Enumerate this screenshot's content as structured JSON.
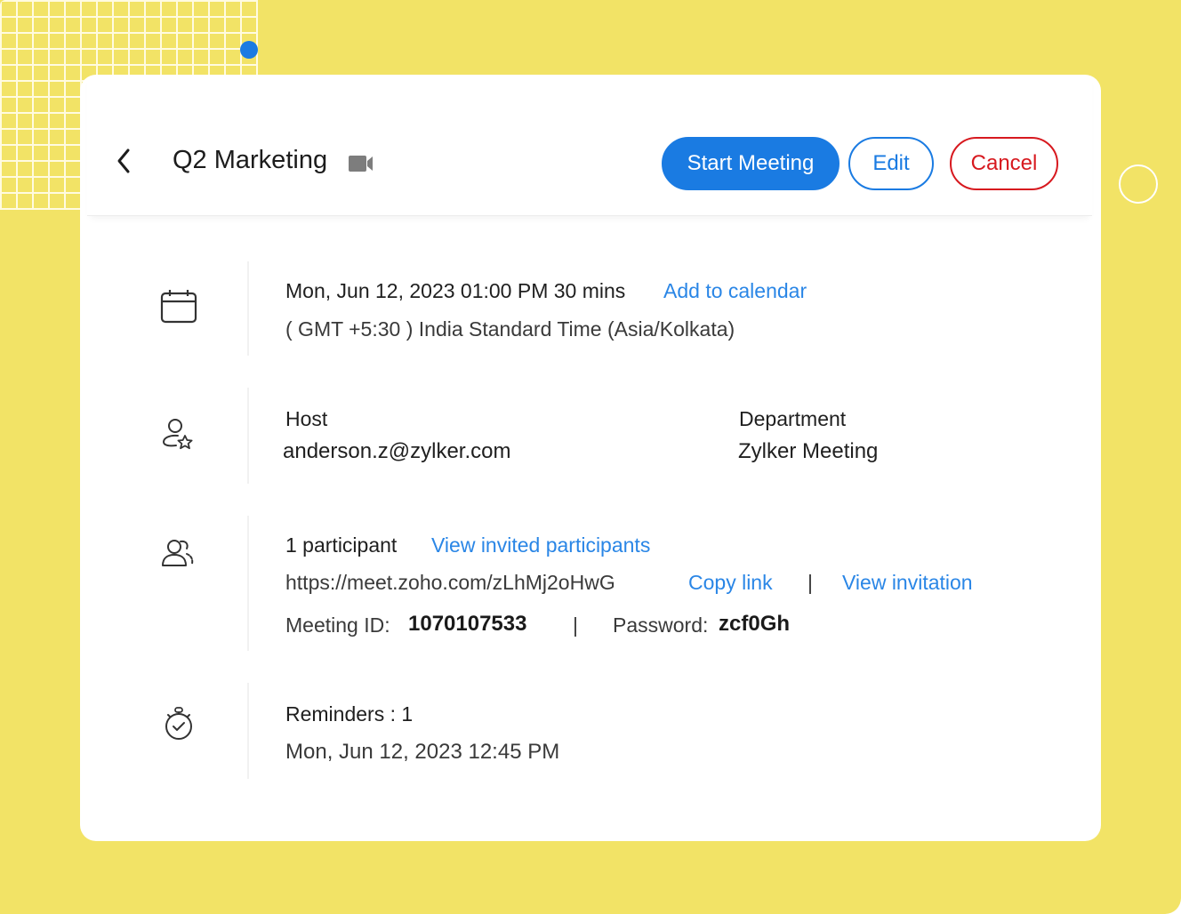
{
  "header": {
    "back_label": "Back",
    "title": "Q2 Marketing",
    "meeting_type_icon": "video-camera-icon",
    "buttons": {
      "start": "Start Meeting",
      "edit": "Edit",
      "cancel": "Cancel"
    }
  },
  "schedule": {
    "icon": "calendar-icon",
    "datetime": "Mon, Jun 12, 2023 01:00 PM 30 mins",
    "add_to_calendar": "Add to calendar",
    "timezone": "( GMT +5:30 ) India Standard Time (Asia/Kolkata)"
  },
  "host": {
    "icon": "host-user-star-icon",
    "host_label": "Host",
    "host_value": "anderson.z@zylker.com",
    "department_label": "Department",
    "department_value": "Zylker Meeting"
  },
  "participants": {
    "icon": "participants-icon",
    "count": "1 participant",
    "view_invited": "View invited participants",
    "link": "https://meet.zoho.com/zLhMj2oHwG",
    "copy_link": "Copy link",
    "separator": "|",
    "view_invitation": "View invitation",
    "meeting_id_label": "Meeting ID:",
    "meeting_id": "1070107533",
    "password_label": "Password:",
    "password": "zcf0Gh"
  },
  "reminders": {
    "icon": "stopwatch-icon",
    "label": "Reminders : 1",
    "time": "Mon, Jun 12, 2023 12:45 PM"
  },
  "colors": {
    "primary": "#1a7be2",
    "danger": "#d7191f",
    "link": "#2a86e6",
    "background": "#f2e366"
  }
}
